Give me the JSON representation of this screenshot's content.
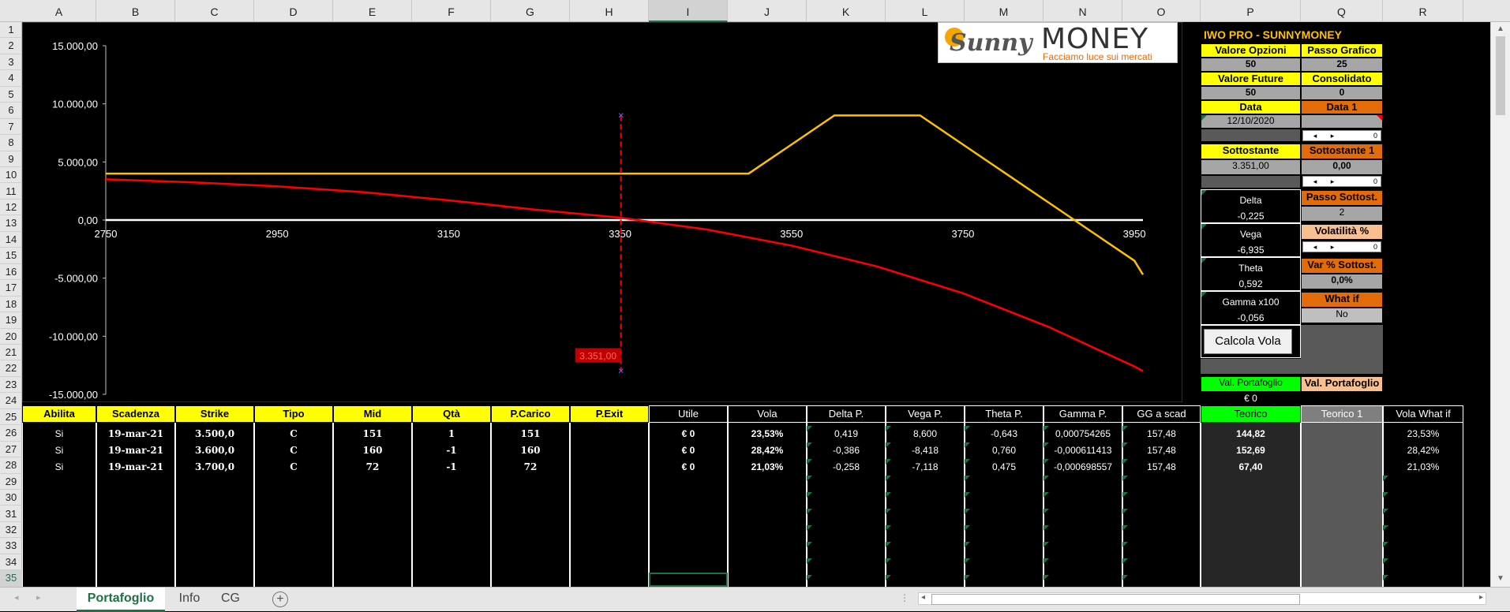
{
  "columns": [
    "A",
    "B",
    "C",
    "D",
    "E",
    "F",
    "G",
    "H",
    "I",
    "J",
    "K",
    "L",
    "M",
    "N",
    "O",
    "P",
    "Q",
    "R"
  ],
  "rows": [
    "1",
    "2",
    "3",
    "4",
    "5",
    "6",
    "7",
    "8",
    "9",
    "10",
    "11",
    "12",
    "13",
    "14",
    "15",
    "16",
    "17",
    "18",
    "19",
    "20",
    "21",
    "22",
    "23",
    "24",
    "25",
    "26",
    "27",
    "28",
    "29",
    "30",
    "31",
    "32",
    "33",
    "34",
    "35"
  ],
  "selected_col": "I",
  "selected_row": "35",
  "logo": {
    "text1": "Sunny",
    "text2": "MONEY",
    "tagline": "Facciamo luce sui mercati"
  },
  "chart_data": {
    "type": "line",
    "y_ticks": [
      "15.000,00",
      "10.000,00",
      "5.000,00",
      "0,00",
      "-5.000,00",
      "-10.000,00",
      "-15.000,00"
    ],
    "x_ticks": [
      "2750",
      "2950",
      "3150",
      "3350",
      "3550",
      "3750",
      "3950"
    ],
    "ylim": [
      -15000,
      15000
    ],
    "xlim": [
      2750,
      3960
    ],
    "marker_label": "3.351,00",
    "marker_x": 3351,
    "series": [
      {
        "color": "#ffc000",
        "x": [
          2750,
          3350,
          3400,
          3450,
          3500,
          3550,
          3600,
          3650,
          3700,
          3750,
          3800,
          3850,
          3900,
          3950,
          3960
        ],
        "values": [
          4000,
          4000,
          4000,
          4000,
          4000,
          6500,
          9000,
          9000,
          9000,
          6500,
          4000,
          1500,
          -1000,
          -3500,
          -4700
        ]
      },
      {
        "color": "#ff0000",
        "x": [
          2750,
          2850,
          2950,
          3050,
          3150,
          3250,
          3350,
          3450,
          3550,
          3650,
          3750,
          3850,
          3950,
          3960
        ],
        "values": [
          3500,
          3250,
          2900,
          2400,
          1700,
          900,
          200,
          -800,
          -2200,
          -4000,
          -6300,
          -9200,
          -12600,
          -13000
        ]
      }
    ]
  },
  "panel": {
    "title": "IWO PRO - SUNNYMONEY",
    "valore_opzioni_label": "Valore Opzioni",
    "valore_opzioni": "50",
    "passo_grafico_label": "Passo Grafico",
    "passo_grafico": "25",
    "valore_future_label": "Valore Future",
    "valore_future": "50",
    "consolidato_label": "Consolidato",
    "consolidato": "0",
    "data_label": "Data",
    "data": "12/10/2020",
    "data1_label": "Data 1",
    "spin1_value": "0",
    "sottostante_label": "Sottostante",
    "sottostante": "3.351,00",
    "sottostante1_label": "Sottostante 1",
    "sottostante1": "0,00",
    "spin2_value": "0",
    "delta_label": "Delta",
    "delta": "-0,225",
    "passo_sottost_label": "Passo Sottost.",
    "passo_sottost": "2",
    "vega_label": "Vega",
    "vega": "-6,935",
    "volatilita_label": "Volatilità %",
    "spin3_value": "0",
    "theta_label": "Theta",
    "theta": "0,592",
    "var_sottost_label": "Var % Sottost.",
    "var_sottost": "0,0%",
    "gamma_label": "Gamma x100",
    "gamma": "-0,056",
    "whatif_label": "What if",
    "whatif": "No",
    "calcola_button": "Calcola Vola",
    "val_portafoglio_label": "Val. Portafoglio",
    "val_portafoglio": "€ 0",
    "val_portafoglio1_label": "Val. Portafoglio"
  },
  "table": {
    "headers": [
      "Abilita",
      "Scadenza",
      "Strike",
      "Tipo",
      "Mid",
      "Qtà",
      "P.Carico",
      "P.Exit",
      "Utile",
      "Vola",
      "Delta P.",
      "Vega P.",
      "Theta P.",
      "Gamma P.",
      "GG a scad",
      "Teorico",
      "Teorico 1",
      "Vola What if"
    ],
    "rows": [
      [
        "Si",
        "19-mar-21",
        "3.500,0",
        "C",
        "151",
        "1",
        "151",
        "",
        "€ 0",
        "23,53%",
        "0,419",
        "8,600",
        "-0,643",
        "0,000754265",
        "157,48",
        "144,82",
        "",
        "23,53%"
      ],
      [
        "Si",
        "19-mar-21",
        "3.600,0",
        "C",
        "160",
        "-1",
        "160",
        "",
        "€ 0",
        "28,42%",
        "-0,386",
        "-8,418",
        "0,760",
        "-0,000611413",
        "157,48",
        "152,69",
        "",
        "28,42%"
      ],
      [
        "Si",
        "19-mar-21",
        "3.700,0",
        "C",
        "72",
        "-1",
        "72",
        "",
        "€ 0",
        "21,03%",
        "-0,258",
        "-7,118",
        "0,475",
        "-0,000698557",
        "157,48",
        "67,40",
        "",
        "21,03%"
      ]
    ]
  },
  "tabs": [
    "Portafoglio",
    "Info",
    "CG"
  ],
  "active_tab": "Portafoglio"
}
